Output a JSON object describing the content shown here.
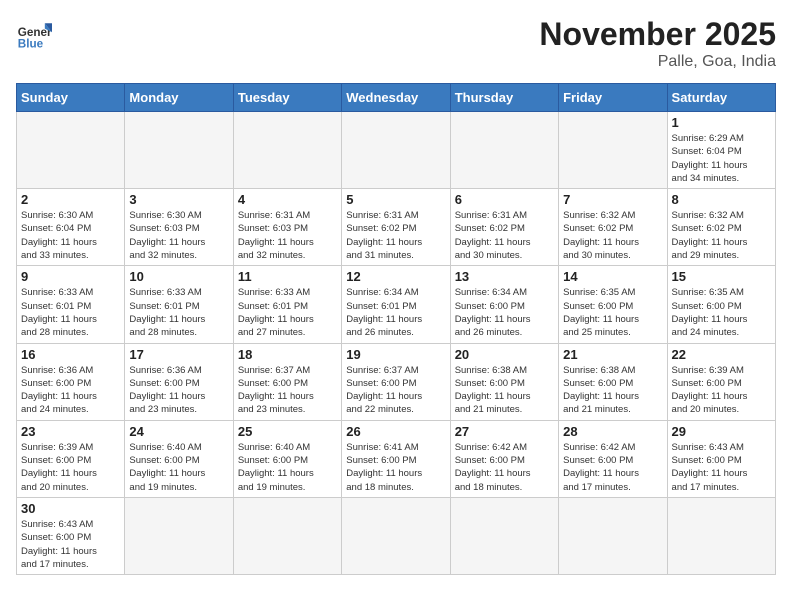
{
  "header": {
    "logo_general": "General",
    "logo_blue": "Blue",
    "month_title": "November 2025",
    "location": "Palle, Goa, India"
  },
  "weekdays": [
    "Sunday",
    "Monday",
    "Tuesday",
    "Wednesday",
    "Thursday",
    "Friday",
    "Saturday"
  ],
  "weeks": [
    [
      {
        "day": "",
        "info": ""
      },
      {
        "day": "",
        "info": ""
      },
      {
        "day": "",
        "info": ""
      },
      {
        "day": "",
        "info": ""
      },
      {
        "day": "",
        "info": ""
      },
      {
        "day": "",
        "info": ""
      },
      {
        "day": "1",
        "info": "Sunrise: 6:29 AM\nSunset: 6:04 PM\nDaylight: 11 hours\nand 34 minutes."
      }
    ],
    [
      {
        "day": "2",
        "info": "Sunrise: 6:30 AM\nSunset: 6:04 PM\nDaylight: 11 hours\nand 33 minutes."
      },
      {
        "day": "3",
        "info": "Sunrise: 6:30 AM\nSunset: 6:03 PM\nDaylight: 11 hours\nand 32 minutes."
      },
      {
        "day": "4",
        "info": "Sunrise: 6:31 AM\nSunset: 6:03 PM\nDaylight: 11 hours\nand 32 minutes."
      },
      {
        "day": "5",
        "info": "Sunrise: 6:31 AM\nSunset: 6:02 PM\nDaylight: 11 hours\nand 31 minutes."
      },
      {
        "day": "6",
        "info": "Sunrise: 6:31 AM\nSunset: 6:02 PM\nDaylight: 11 hours\nand 30 minutes."
      },
      {
        "day": "7",
        "info": "Sunrise: 6:32 AM\nSunset: 6:02 PM\nDaylight: 11 hours\nand 30 minutes."
      },
      {
        "day": "8",
        "info": "Sunrise: 6:32 AM\nSunset: 6:02 PM\nDaylight: 11 hours\nand 29 minutes."
      }
    ],
    [
      {
        "day": "9",
        "info": "Sunrise: 6:33 AM\nSunset: 6:01 PM\nDaylight: 11 hours\nand 28 minutes."
      },
      {
        "day": "10",
        "info": "Sunrise: 6:33 AM\nSunset: 6:01 PM\nDaylight: 11 hours\nand 28 minutes."
      },
      {
        "day": "11",
        "info": "Sunrise: 6:33 AM\nSunset: 6:01 PM\nDaylight: 11 hours\nand 27 minutes."
      },
      {
        "day": "12",
        "info": "Sunrise: 6:34 AM\nSunset: 6:01 PM\nDaylight: 11 hours\nand 26 minutes."
      },
      {
        "day": "13",
        "info": "Sunrise: 6:34 AM\nSunset: 6:00 PM\nDaylight: 11 hours\nand 26 minutes."
      },
      {
        "day": "14",
        "info": "Sunrise: 6:35 AM\nSunset: 6:00 PM\nDaylight: 11 hours\nand 25 minutes."
      },
      {
        "day": "15",
        "info": "Sunrise: 6:35 AM\nSunset: 6:00 PM\nDaylight: 11 hours\nand 24 minutes."
      }
    ],
    [
      {
        "day": "16",
        "info": "Sunrise: 6:36 AM\nSunset: 6:00 PM\nDaylight: 11 hours\nand 24 minutes."
      },
      {
        "day": "17",
        "info": "Sunrise: 6:36 AM\nSunset: 6:00 PM\nDaylight: 11 hours\nand 23 minutes."
      },
      {
        "day": "18",
        "info": "Sunrise: 6:37 AM\nSunset: 6:00 PM\nDaylight: 11 hours\nand 23 minutes."
      },
      {
        "day": "19",
        "info": "Sunrise: 6:37 AM\nSunset: 6:00 PM\nDaylight: 11 hours\nand 22 minutes."
      },
      {
        "day": "20",
        "info": "Sunrise: 6:38 AM\nSunset: 6:00 PM\nDaylight: 11 hours\nand 21 minutes."
      },
      {
        "day": "21",
        "info": "Sunrise: 6:38 AM\nSunset: 6:00 PM\nDaylight: 11 hours\nand 21 minutes."
      },
      {
        "day": "22",
        "info": "Sunrise: 6:39 AM\nSunset: 6:00 PM\nDaylight: 11 hours\nand 20 minutes."
      }
    ],
    [
      {
        "day": "23",
        "info": "Sunrise: 6:39 AM\nSunset: 6:00 PM\nDaylight: 11 hours\nand 20 minutes."
      },
      {
        "day": "24",
        "info": "Sunrise: 6:40 AM\nSunset: 6:00 PM\nDaylight: 11 hours\nand 19 minutes."
      },
      {
        "day": "25",
        "info": "Sunrise: 6:40 AM\nSunset: 6:00 PM\nDaylight: 11 hours\nand 19 minutes."
      },
      {
        "day": "26",
        "info": "Sunrise: 6:41 AM\nSunset: 6:00 PM\nDaylight: 11 hours\nand 18 minutes."
      },
      {
        "day": "27",
        "info": "Sunrise: 6:42 AM\nSunset: 6:00 PM\nDaylight: 11 hours\nand 18 minutes."
      },
      {
        "day": "28",
        "info": "Sunrise: 6:42 AM\nSunset: 6:00 PM\nDaylight: 11 hours\nand 17 minutes."
      },
      {
        "day": "29",
        "info": "Sunrise: 6:43 AM\nSunset: 6:00 PM\nDaylight: 11 hours\nand 17 minutes."
      }
    ],
    [
      {
        "day": "30",
        "info": "Sunrise: 6:43 AM\nSunset: 6:00 PM\nDaylight: 11 hours\nand 17 minutes."
      },
      {
        "day": "",
        "info": ""
      },
      {
        "day": "",
        "info": ""
      },
      {
        "day": "",
        "info": ""
      },
      {
        "day": "",
        "info": ""
      },
      {
        "day": "",
        "info": ""
      },
      {
        "day": "",
        "info": ""
      }
    ]
  ]
}
